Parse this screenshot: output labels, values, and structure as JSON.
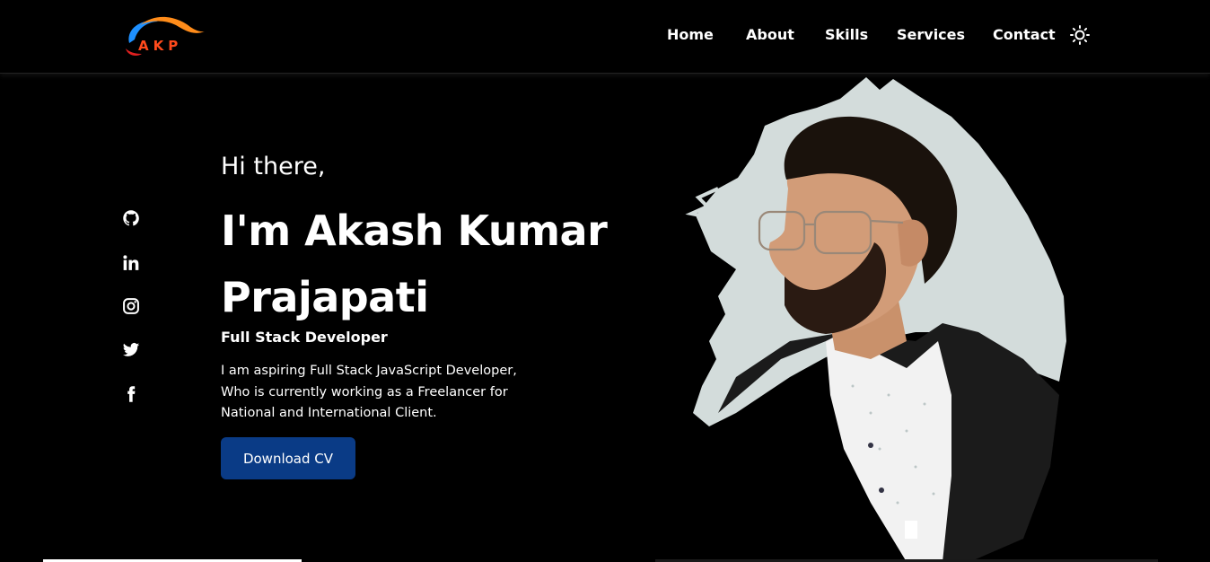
{
  "logo": {
    "text": "AKP",
    "colors": {
      "swoosh_blue": "#1e90ff",
      "swoosh_orange": "#ff8c1a",
      "text": "#ff4a1c"
    }
  },
  "nav": {
    "items": [
      {
        "label": "Home"
      },
      {
        "label": "About"
      },
      {
        "label": "Skills"
      },
      {
        "label": "Services"
      },
      {
        "label": "Contact"
      }
    ],
    "theme_toggle_icon": "sun-icon"
  },
  "socials": [
    {
      "icon": "github-icon"
    },
    {
      "icon": "linkedin-icon"
    },
    {
      "icon": "instagram-icon"
    },
    {
      "icon": "twitter-icon"
    },
    {
      "icon": "facebook-icon"
    }
  ],
  "hero": {
    "greeting": "Hi there,",
    "name_line1": "I'm Akash Kumar",
    "name_line2": "Prajapati",
    "role": "Full Stack Developer",
    "desc_line1": "I am aspiring Full Stack JavaScript Developer,",
    "desc_line2": "Who is currently working as a Freelancer for",
    "desc_line3": "National and International Client.",
    "cta_label": "Download CV"
  },
  "colors": {
    "background": "#000000",
    "button": "#0a3b86",
    "portrait_backdrop": "#d3dcdb"
  }
}
